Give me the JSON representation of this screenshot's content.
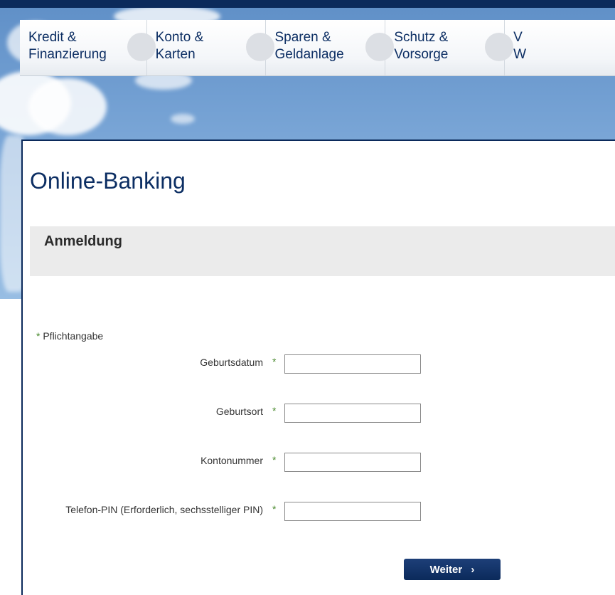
{
  "nav": {
    "items": [
      {
        "label": "Kredit &\nFinanzierung"
      },
      {
        "label": "Konto &\nKarten"
      },
      {
        "label": "Sparen &\nGeldanlage"
      },
      {
        "label": "Schutz &\nVorsorge"
      },
      {
        "label": "V\nW"
      }
    ]
  },
  "page": {
    "title": "Online-Banking",
    "section_title": "Anmeldung",
    "required_marker": "*",
    "required_note": "Pflichtangabe"
  },
  "form": {
    "fields": [
      {
        "label": "Geburtsdatum",
        "value": "",
        "placeholder": ""
      },
      {
        "label": "Geburtsort",
        "value": "",
        "placeholder": ""
      },
      {
        "label": "Kontonummer",
        "value": "",
        "placeholder": ""
      },
      {
        "label": "Telefon-PIN (Erforderlich, sechsstelliger PIN)",
        "value": "",
        "placeholder": ""
      }
    ],
    "submit_label": "Weiter",
    "submit_icon": "chevron-right-icon"
  },
  "colors": {
    "brand_dark": "#0b2a5b",
    "nav_text": "#0c2e63",
    "required_star": "#4a8a2e",
    "section_bg": "#ebebeb"
  }
}
